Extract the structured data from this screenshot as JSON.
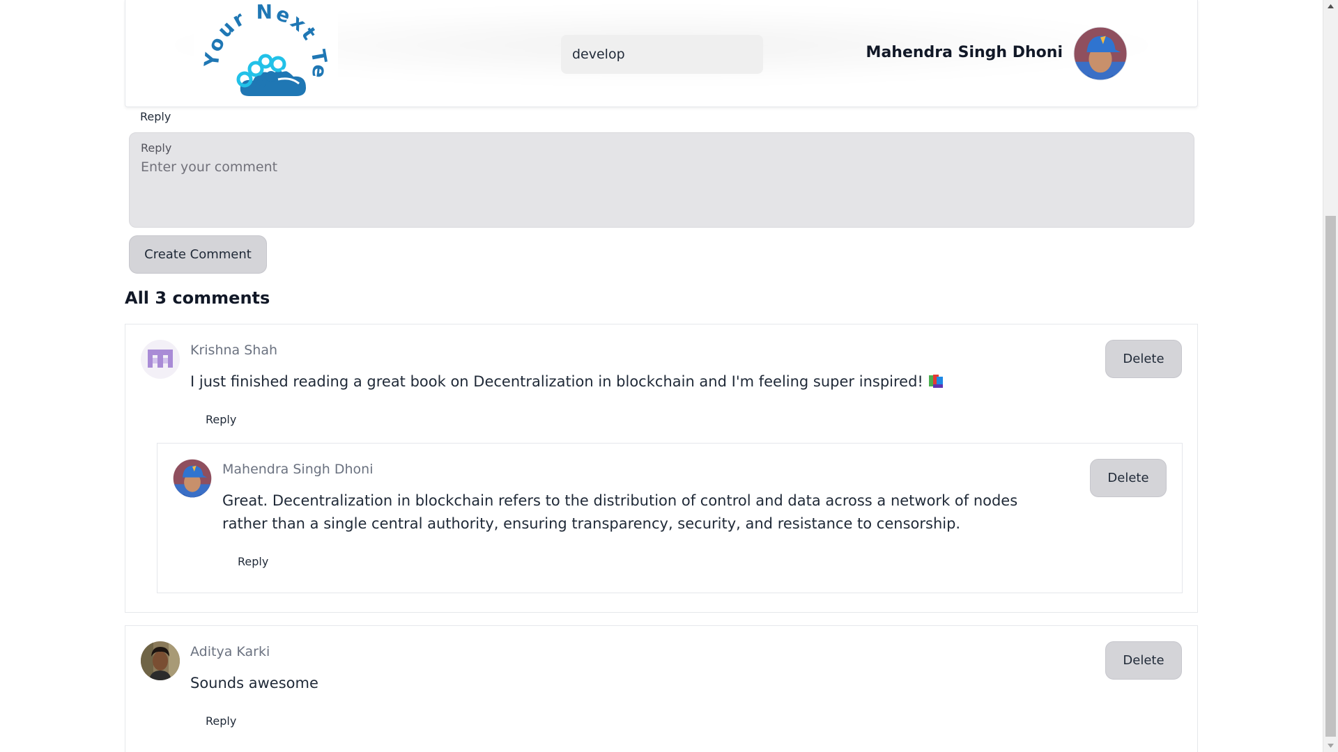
{
  "header": {
    "logo_text": "Your Next Tech",
    "search_value": "develop",
    "user_name": "Mahendra Singh Dhoni"
  },
  "form": {
    "top_reply_link": "Reply",
    "label": "Reply",
    "placeholder": "Enter your comment",
    "submit_label": "Create Comment"
  },
  "comments_heading": "All 3 comments",
  "comments": [
    {
      "author": "Krishna Shah",
      "text": "I just finished reading a great book on Decentralization in blockchain and I'm feeling super inspired!",
      "emoji": "books-emoji",
      "reply_label": "Reply",
      "delete_label": "Delete",
      "replies": [
        {
          "author": "Mahendra Singh Dhoni",
          "text": "Great. Decentralization in blockchain refers to the distribution of control and data across a network of nodes rather than a single central authority, ensuring transparency, security, and resistance to censorship.",
          "reply_label": "Reply",
          "delete_label": "Delete"
        }
      ]
    },
    {
      "author": "Aditya Karki",
      "text": "Sounds awesome",
      "reply_label": "Reply",
      "delete_label": "Delete"
    }
  ],
  "colors": {
    "button_bg": "#d4d4d8",
    "form_bg": "#e4e4e7",
    "author_text": "#6b7280",
    "logo_blue": "#1f77b4",
    "logo_cyan": "#22c1e8"
  },
  "icons": {
    "scroll_up": "scroll-up-arrow-icon",
    "scroll_down": "scroll-down-arrow-icon"
  }
}
